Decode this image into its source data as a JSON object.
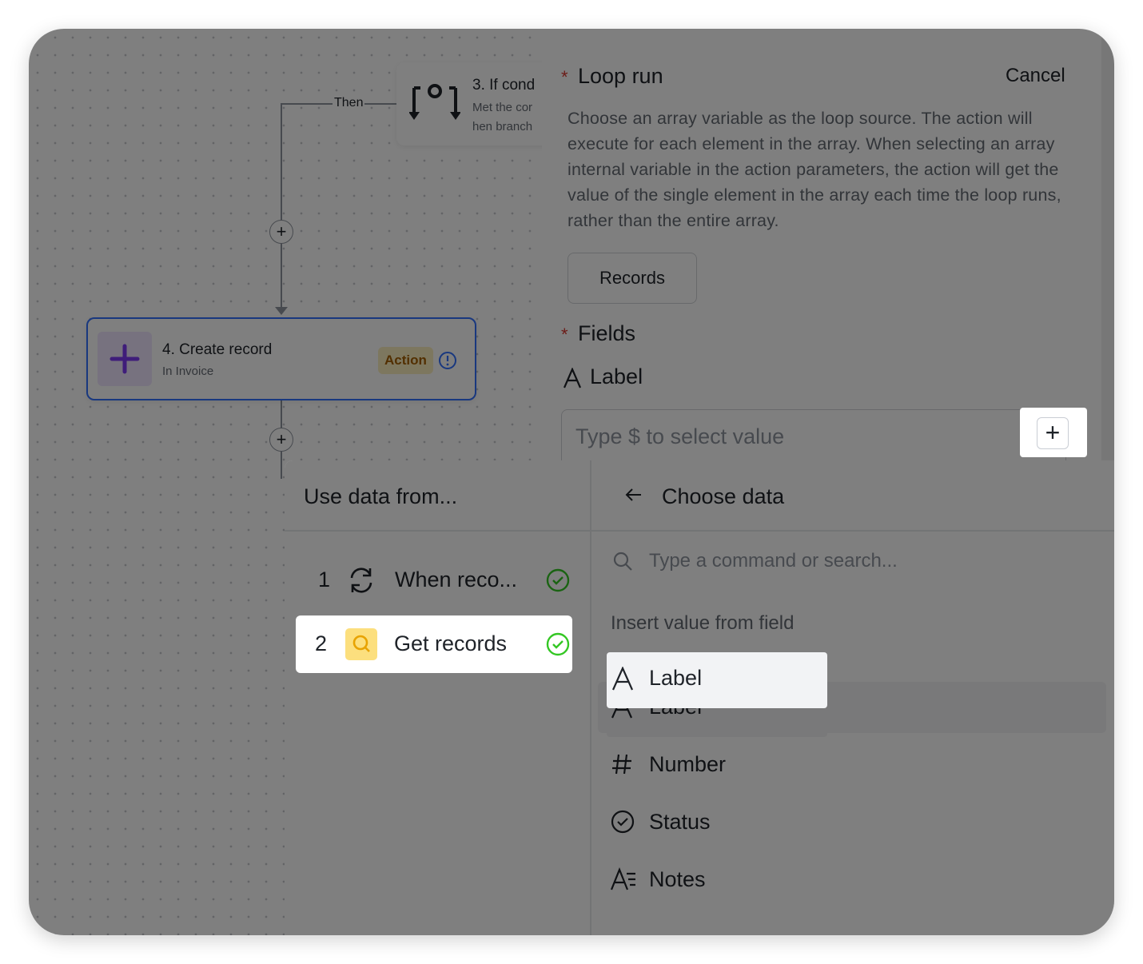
{
  "canvas": {
    "node3": {
      "title": "3. If cond",
      "line1": "Met the cor",
      "line2": "hen branch"
    },
    "then_label": "Then",
    "add_symbol": "+",
    "node4": {
      "title": "4. Create record",
      "subtitle": "In Invoice",
      "badge": "Action"
    }
  },
  "panel": {
    "loop_title": "Loop run",
    "cancel": "Cancel",
    "description": "Choose an array variable as the loop source. The action will execute for each element in the array. When selecting an array internal variable in the action parameters, the action will get the value of the single element in the array each time the loop runs, rather than the entire array.",
    "records_button": "Records",
    "fields_title": "Fields",
    "required_mark": "*",
    "label_field": "Label",
    "input_placeholder": "Type $ to select value",
    "plus_symbol": "+"
  },
  "dropdown": {
    "left_title": "Use data from...",
    "right_title": "Choose data",
    "steps": [
      {
        "num": "1",
        "label": "When reco...",
        "icon": "refresh-icon"
      },
      {
        "num": "2",
        "label": "Get records",
        "icon": "search-icon"
      }
    ],
    "search_placeholder": "Type a command or search...",
    "section_label": "Insert value from field",
    "fields": [
      {
        "label": "Label",
        "icon": "text-icon"
      },
      {
        "label": "Number",
        "icon": "hash-icon"
      },
      {
        "label": "Status",
        "icon": "status-icon"
      },
      {
        "label": "Notes",
        "icon": "long-text-icon"
      }
    ]
  },
  "colors": {
    "accent": "#3370ff",
    "success": "#34c724",
    "required": "#d83931",
    "badge_bg": "#fbeebf",
    "badge_text": "#a45e00",
    "add_icon": "#7f3bf5"
  }
}
